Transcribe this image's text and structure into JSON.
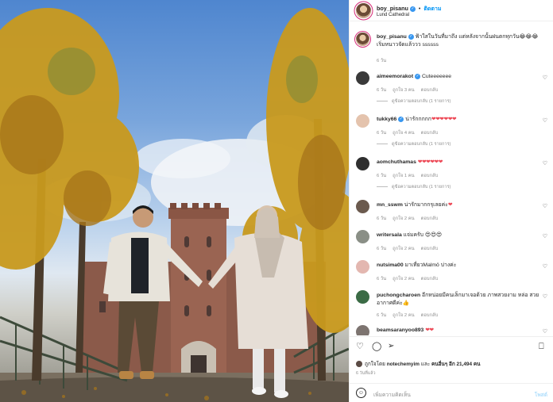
{
  "post": {
    "owner": "boy_pisanu",
    "follow_label": "ติดตาม",
    "location": "Lund Cathedral",
    "caption_user": "boy_pisanu",
    "caption_text": "ฟ้าใสในวันที่มาถึง แต่หลังจากนั้นฝนตกทุกวัน😂😂😂 เริ่มหนาวจัดแล้ววว ssssss",
    "caption_age": "6 วัน"
  },
  "labels": {
    "likes_label": "ถูกใจ",
    "reply_label": "ตอบกลับ"
  },
  "comments": [
    {
      "user": "aimeemorakot",
      "verified": true,
      "text": "Cuteeeeeee",
      "age": "6 วัน",
      "likes": "ถูกใจ 3 คน",
      "replies": "ดูข้อความตอบกลับ (1 รายการ)"
    },
    {
      "user": "tukky66",
      "verified": true,
      "text": "น่ารักกกกก",
      "hearts": "❤❤❤❤❤❤",
      "age": "6 วัน",
      "likes": "ถูกใจ 4 คน",
      "replies": "ดูข้อความตอบกลับ (1 รายการ)"
    },
    {
      "user": "aomchuthamas",
      "verified": false,
      "text": "",
      "hearts": "❤❤❤❤❤❤",
      "age": "6 วัน",
      "likes": "ถูกใจ 1 คน",
      "replies": "ดูข้อความตอบกลับ (1 รายการ)"
    },
    {
      "user": "mn_sswm",
      "verified": false,
      "text": "น่ารักมากกรุเลยค่ะ",
      "hearts": "❤",
      "age": "6 วัน",
      "likes": "ถูกใจ 2 คน"
    },
    {
      "user": "writersala",
      "verified": false,
      "text": "แจ่มครับ 😍😍😍",
      "age": "6 วัน",
      "likes": "ถูกใจ 2 คน"
    },
    {
      "user": "nutsima00",
      "verified": false,
      "text": "มาเที่ยวMalmö บ่างค่ะ",
      "age": "6 วัน",
      "likes": "ถูกใจ 2 คน"
    },
    {
      "user": "puchongcharoen",
      "verified": false,
      "text": "อีกหน่อยมีคนเล็กมาเจอด้วย ภาพสวยงาม หล่อ สวย อากาศดีค่ะ👍",
      "age": "6 วัน",
      "likes": "ถูกใจ 2 คน"
    },
    {
      "user": "beamsaranyoo893",
      "verified": false,
      "text": "",
      "hearts": "❤❤",
      "age": "",
      "likes": ""
    }
  ],
  "footer": {
    "icons": [
      "heart-outline-icon",
      "comment-icon",
      "share-icon",
      "bookmark-icon"
    ],
    "liked_by_prefix": "ถูกใจโดย",
    "liked_by_user": "notechemyim",
    "liked_by_and": "และ",
    "liked_by_others": "คนอื่นๆ อีก 21,494 คน",
    "post_age": "6 วันที่แล้ว",
    "add_comment_placeholder": "เพิ่มความคิดเห็น",
    "post_button": "โพสต์"
  },
  "colors": {
    "accent": "#0095f6",
    "verified": "#3897f0",
    "heart": "#ed4956",
    "muted": "#8e8e8e"
  }
}
